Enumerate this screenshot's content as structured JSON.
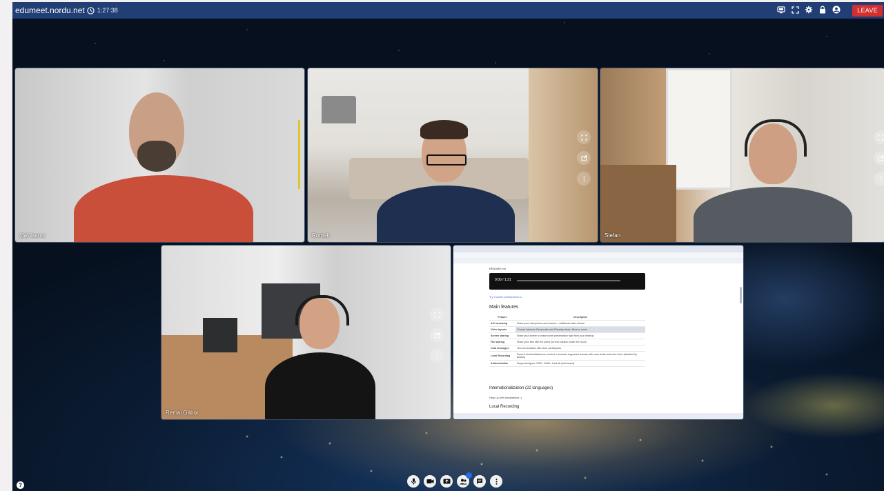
{
  "topbar": {
    "room_name": "edumeet.nordu.net",
    "timer": "1:27:38",
    "icons": [
      "screen-share-icon",
      "fullscreen-icon",
      "settings-icon",
      "lock-icon",
      "account-icon"
    ],
    "leave_label": "LEAVE"
  },
  "tiles": [
    {
      "name": "(Ja) Isarus"
    },
    {
      "name": "Romek"
    },
    {
      "name": "Stefan"
    },
    {
      "name": "Remai Gábor"
    }
  ],
  "share": {
    "title": "README.md",
    "video_time": "0:00 / 1:21",
    "link_text": "Try it online at letsmeet.no",
    "heading_main": "Main features",
    "table": {
      "headers": [
        "Feature",
        "Description"
      ],
      "rows": [
        [
          "A/V streaming",
          "Share your microphone and camera + additional video stream"
        ],
        [
          "Video layouts",
          "Choose between Democratic and Filmstrip views. More to come."
        ],
        [
          "Screen sharing",
          "Share your screen to make some presentation right from your desktop"
        ],
        [
          "File sharing",
          "Share your files with the peers (torrent solution under the hood)"
        ],
        [
          "Chat messages",
          "Text conversation with other participants"
        ],
        [
          "Local Recording",
          "Record window/tab/screen content in browser supported formats with room audio and save them (disabled by default)"
        ],
        [
          "Authentication",
          "Supported types: OIDC, SAML, local db (text based)"
        ]
      ]
    },
    "heading_i18n": "Internationalization (22 languages)",
    "i18n_note": "Help us with translations :)",
    "heading_rec": "Local Recording"
  },
  "colors": {
    "topbar": "#213e75",
    "leave": "#d32f2f"
  }
}
